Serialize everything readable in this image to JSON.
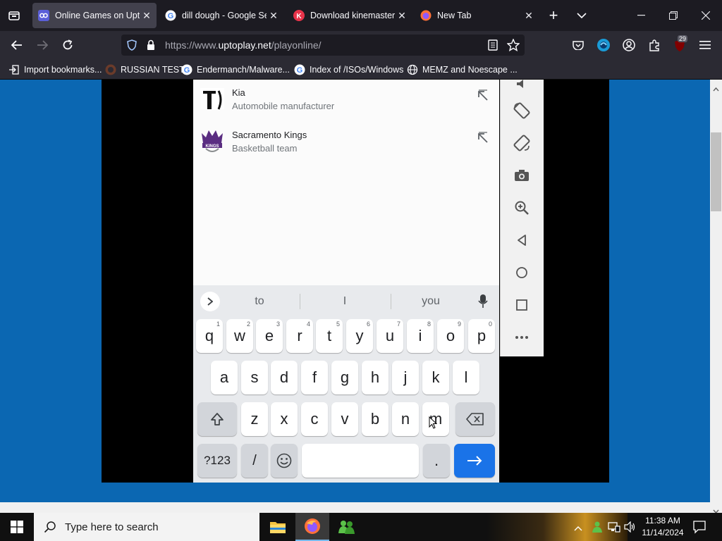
{
  "browser": {
    "tabs": [
      {
        "title": "Online Games on Uptopl",
        "active": true,
        "icon": "uptoplay-icon"
      },
      {
        "title": "dill dough - Google Sear",
        "active": false,
        "icon": "google-icon"
      },
      {
        "title": "Download kinemaster",
        "active": false,
        "icon": "kinemaster-icon"
      },
      {
        "title": "New Tab",
        "active": false,
        "icon": "firefox-icon"
      }
    ],
    "url_prefix": "https://www.",
    "url_host": "uptoplay.net",
    "url_path": "/playonline/",
    "extension_badge": "29",
    "bookmarks": [
      {
        "label": "Import bookmarks...",
        "icon": "import-icon"
      },
      {
        "label": "RUSSIAN TEST",
        "icon": "github-icon"
      },
      {
        "label": "Endermanch/Malware...",
        "icon": "google-icon"
      },
      {
        "label": "Index of /ISOs/Windows",
        "icon": "google-icon"
      },
      {
        "label": "MEMZ and Noescape ...",
        "icon": "globe-icon"
      }
    ]
  },
  "results": [
    {
      "name": "Kia",
      "desc": "Automobile manufacturer"
    },
    {
      "name": "Sacramento Kings",
      "desc": "Basketball team"
    }
  ],
  "keyboard": {
    "suggestions": [
      "to",
      "I",
      "you"
    ],
    "row1": [
      {
        "k": "q",
        "h": "1"
      },
      {
        "k": "w",
        "h": "2"
      },
      {
        "k": "e",
        "h": "3"
      },
      {
        "k": "r",
        "h": "4"
      },
      {
        "k": "t",
        "h": "5"
      },
      {
        "k": "y",
        "h": "6"
      },
      {
        "k": "u",
        "h": "7"
      },
      {
        "k": "i",
        "h": "8"
      },
      {
        "k": "o",
        "h": "9"
      },
      {
        "k": "p",
        "h": "0"
      }
    ],
    "row2": [
      "a",
      "s",
      "d",
      "f",
      "g",
      "h",
      "j",
      "k",
      "l"
    ],
    "row3": [
      "z",
      "x",
      "c",
      "v",
      "b",
      "n",
      "m"
    ],
    "symbols_label": "?123",
    "slash_label": "/",
    "period_label": "."
  },
  "taskbar": {
    "search_placeholder": "Type here to search",
    "time": "11:38 AM",
    "date": "11/14/2024"
  },
  "colors": {
    "page_bg": "#0b67b2",
    "enter_key": "#1a73e8",
    "browser_bg": "#1c1b22"
  }
}
